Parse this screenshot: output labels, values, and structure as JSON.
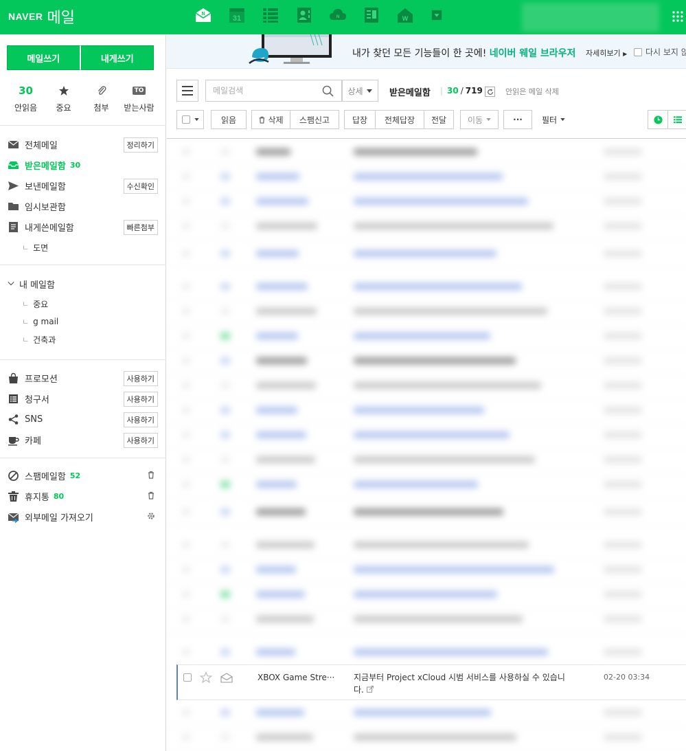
{
  "header": {
    "logo_brand": "NAVER",
    "logo_service": "메일"
  },
  "compose": {
    "write": "메일쓰기",
    "self": "내게쓰기"
  },
  "quick": [
    {
      "value": "30",
      "label": "안읽음"
    },
    {
      "icon": "star-icon",
      "label": "중요"
    },
    {
      "icon": "paperclip-icon",
      "label": "첨부"
    },
    {
      "badge": "TO",
      "label": "받는사람"
    }
  ],
  "nav": {
    "all": {
      "label": "전체메일",
      "button": "정리하기"
    },
    "inbox": {
      "label": "받은메일함",
      "count": "30"
    },
    "sent": {
      "label": "보낸메일함",
      "button": "수신확인"
    },
    "drafts": {
      "label": "임시보관함"
    },
    "self": {
      "label": "내게쓴메일함",
      "button": "빠른첨부"
    },
    "self_sub": "도면"
  },
  "mybox": {
    "title": "내 메일함",
    "items": [
      "중요",
      "g mail",
      "건축과"
    ]
  },
  "smart": [
    {
      "label": "프로모션",
      "button": "사용하기"
    },
    {
      "label": "청구서",
      "button": "사용하기"
    },
    {
      "label": "SNS",
      "button": "사용하기"
    },
    {
      "label": "카페",
      "button": "사용하기"
    }
  ],
  "bottom": {
    "spam": {
      "label": "스팸메일함",
      "count": "52"
    },
    "trash": {
      "label": "휴지통",
      "count": "80"
    },
    "external": {
      "label": "외부메일 가져오기"
    }
  },
  "banner": {
    "text": "내가 찾던 모든 기능들이 한 곳에!",
    "highlight": "네이버 웨일 브라우저",
    "more": "자세히보기",
    "hide": "다시 보지 않"
  },
  "toolbar": {
    "search_placeholder": "메일검색",
    "detail": "상세",
    "folder_title": "받은메일함",
    "unread": "30",
    "total": "719",
    "delete_unread": "안읽은 메일 삭제",
    "read": "읽음",
    "delete": "삭제",
    "spam": "스팸신고",
    "reply": "답장",
    "reply_all": "전체답장",
    "forward": "전달",
    "move": "이동",
    "more": "···",
    "filter": "필터"
  },
  "visible_mail": {
    "from": "XBOX Game Stre···",
    "subject": "지금부터 Project xCloud 시범 서비스를 사용하실 수 있습니다.",
    "date": "02-20 03:34"
  },
  "colors": {
    "brand": "#03c75a",
    "highlight": "#08b27d",
    "focus": "#5b7fd6"
  }
}
